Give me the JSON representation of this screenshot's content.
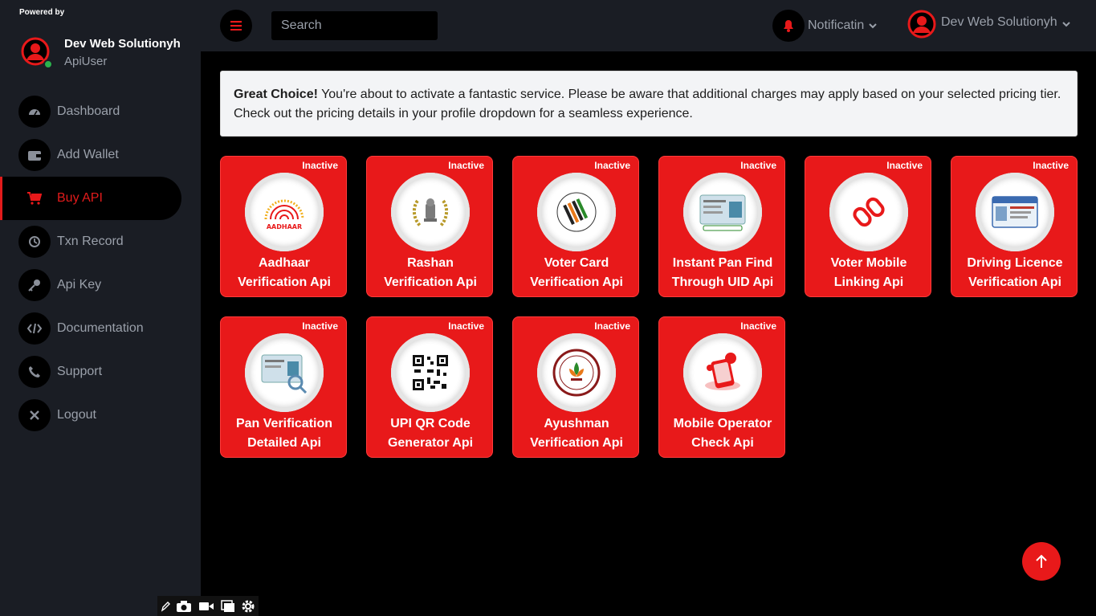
{
  "sidebar": {
    "powered_by": "Powered by",
    "user_name": "Dev Web Solutionyh",
    "user_role": "ApiUser",
    "items": [
      {
        "label": "Dashboard",
        "icon": "gauge-icon"
      },
      {
        "label": "Add Wallet",
        "icon": "wallet-icon"
      },
      {
        "label": "Buy API",
        "icon": "cart-icon",
        "active": true
      },
      {
        "label": "Txn Record",
        "icon": "history-icon"
      },
      {
        "label": "Api Key",
        "icon": "key-icon"
      },
      {
        "label": "Documentation",
        "icon": "code-icon"
      },
      {
        "label": "Support",
        "icon": "phone-icon"
      },
      {
        "label": "Logout",
        "icon": "close-icon"
      }
    ]
  },
  "header": {
    "search_placeholder": "Search",
    "notification_label": "Notificatin",
    "user_label": "Dev Web Solutionyh"
  },
  "alert": {
    "bold": "Great Choice!",
    "text": " You're about to activate a fantastic service. Please be aware that additional charges may apply based on your selected pricing tier. Check out the pricing details in your profile dropdown for a seamless experience."
  },
  "cards": [
    {
      "status": "Inactive",
      "line1": "Aadhaar",
      "line2": "Verification Api",
      "logo": "aadhaar-logo"
    },
    {
      "status": "Inactive",
      "line1": "Rashan",
      "line2": "Verification Api",
      "logo": "emblem-logo"
    },
    {
      "status": "Inactive",
      "line1": "Voter Card",
      "line2": "Verification Api",
      "logo": "election-logo"
    },
    {
      "status": "Inactive",
      "line1": "Instant Pan Find",
      "line2": "Through UID Api",
      "logo": "pan-card-logo"
    },
    {
      "status": "Inactive",
      "line1": "Voter Mobile",
      "line2": "Linking Api",
      "logo": "link-logo"
    },
    {
      "status": "Inactive",
      "line1": "Driving Licence",
      "line2": "Verification Api",
      "logo": "licence-logo"
    },
    {
      "status": "Inactive",
      "line1": "Pan Verification",
      "line2": "Detailed Api",
      "logo": "pan-detail-logo"
    },
    {
      "status": "Inactive",
      "line1": "UPI QR Code",
      "line2": "Generator Api",
      "logo": "qr-logo"
    },
    {
      "status": "Inactive",
      "line1": "Ayushman",
      "line2": "Verification Api",
      "logo": "ayushman-logo"
    },
    {
      "status": "Inactive",
      "line1": "Mobile Operator",
      "line2": "Check Api",
      "logo": "mobile-operator-logo"
    }
  ],
  "colors": {
    "accent": "#e8191a",
    "sidebar_bg": "#1a1d24",
    "page_bg": "#000000"
  }
}
